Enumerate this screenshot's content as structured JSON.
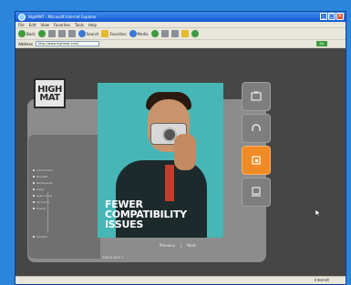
{
  "window": {
    "title": "HighMAT - Microsoft Internet Explorer",
    "buttons": [
      "_",
      "□",
      "×"
    ]
  },
  "menubar": [
    "File",
    "Edit",
    "View",
    "Favorites",
    "Tools",
    "Help"
  ],
  "toolbar": {
    "back_label": "Back",
    "search_label": "Search",
    "favorites_label": "Favorites",
    "media_label": "Media"
  },
  "addressbar": {
    "label": "Address",
    "url": "http://www.highmat.com/",
    "go_label": "Go"
  },
  "site": {
    "logo_line1": "HIGH",
    "logo_line2": "MAT",
    "nav_items": [
      "Introduction",
      "Benefits",
      "Participants",
      "Press",
      "Learn more",
      "Technical",
      "Events"
    ],
    "nav_bottom": "Contact",
    "headline_lines": [
      "FEWER",
      "COMPATIBILITY",
      "ISSUES"
    ],
    "pager": {
      "prev_label": "Previous",
      "next_label": "Next",
      "sep": "|"
    },
    "footer_link": "INDEX INFO ?"
  },
  "statusbar": {
    "text": "",
    "zone": "Internet"
  },
  "icons": {
    "side_buttons": [
      "tv-icon",
      "headphones-icon",
      "photo-icon",
      "computer-icon"
    ],
    "active_side_button": "photo-icon"
  },
  "colors": {
    "accent_orange": "#f08a24",
    "photo_bg": "#46b7b6",
    "page_bg": "#464646"
  }
}
